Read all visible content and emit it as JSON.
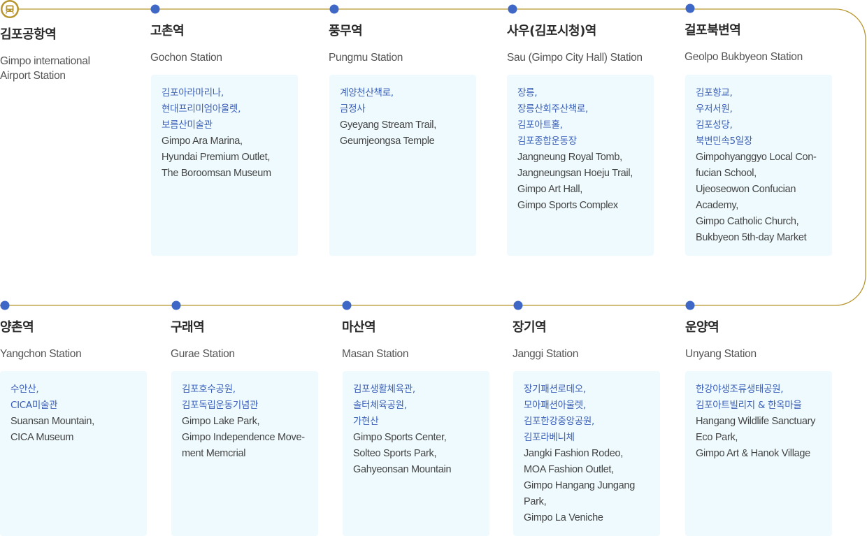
{
  "colors": {
    "track": "#b8962e",
    "dot": "#3f67c5",
    "airport_ring": "#b8962e",
    "card_bg": "#eefafd",
    "ko_text": "#3a5fb8"
  },
  "stations": [
    {
      "ko": "김포공항역",
      "en": "Gimpo international Airport Station",
      "icon": "train-icon",
      "lines": []
    },
    {
      "ko": "고촌역",
      "en": "Gochon Station",
      "lines": [
        {
          "t": "김포아라마리나,",
          "k": true
        },
        {
          "t": "현대프리미엄아울렛,",
          "k": true
        },
        {
          "t": "보름산미술관",
          "k": true
        },
        {
          "t": "Gimpo Ara Marina,",
          "k": false
        },
        {
          "t": "Hyundai Premium Outlet,",
          "k": false
        },
        {
          "t": "The Boroomsan Museum",
          "k": false
        }
      ]
    },
    {
      "ko": "풍무역",
      "en": "Pungmu Station",
      "lines": [
        {
          "t": "계양천산책로,",
          "k": true
        },
        {
          "t": "금정사",
          "k": true
        },
        {
          "t": "Gyeyang Stream Trail,",
          "k": false
        },
        {
          "t": "Geumjeongsa Temple",
          "k": false
        }
      ]
    },
    {
      "ko": "사우(김포시청)역",
      "en": "Sau (Gimpo City Hall) Station",
      "lines": [
        {
          "t": "장릉,",
          "k": true
        },
        {
          "t": "장릉산회주산책로,",
          "k": true
        },
        {
          "t": "김포아트홀,",
          "k": true
        },
        {
          "t": "김포종합운동장",
          "k": true
        },
        {
          "t": "Jangneung Royal Tomb,",
          "k": false
        },
        {
          "t": "Jangneungsan Hoeju Trail,",
          "k": false
        },
        {
          "t": "Gimpo Art Hall,",
          "k": false
        },
        {
          "t": "Gimpo Sports Complex",
          "k": false
        }
      ]
    },
    {
      "ko": "걸포북변역",
      "en": "Geolpo Bukbyeon Station",
      "lines": [
        {
          "t": "김포향교,",
          "k": true
        },
        {
          "t": "우저서원,",
          "k": true
        },
        {
          "t": "김포성당,",
          "k": true
        },
        {
          "t": "북변민속5일장",
          "k": true
        },
        {
          "t": "Gimpohyanggyo Local Con-",
          "k": false
        },
        {
          "t": "fucian School,",
          "k": false
        },
        {
          "t": "Ujeoseowon Confucian",
          "k": false
        },
        {
          "t": "Academy,",
          "k": false
        },
        {
          "t": "Gimpo Catholic Church,",
          "k": false
        },
        {
          "t": "Bukbyeon 5th-day Market",
          "k": false
        }
      ]
    },
    {
      "ko": "양촌역",
      "en": "Yangchon Station",
      "lines": [
        {
          "t": "수안산,",
          "k": true
        },
        {
          "t": "CICA미술관",
          "k": true
        },
        {
          "t": "Suansan Mountain,",
          "k": false
        },
        {
          "t": "CICA Museum",
          "k": false
        }
      ]
    },
    {
      "ko": "구래역",
      "en": "Gurae Station",
      "lines": [
        {
          "t": "김포호수공원,",
          "k": true
        },
        {
          "t": "김포독립운동기념관",
          "k": true
        },
        {
          "t": "Gimpo Lake Park,",
          "k": false
        },
        {
          "t": "Gimpo Independence Move-",
          "k": false
        },
        {
          "t": "ment Memcrial",
          "k": false
        }
      ]
    },
    {
      "ko": "마산역",
      "en": "Masan Station",
      "lines": [
        {
          "t": "김포생활체육관,",
          "k": true
        },
        {
          "t": "솔터체육공원,",
          "k": true
        },
        {
          "t": "가현산",
          "k": true
        },
        {
          "t": "Gimpo Sports Center,",
          "k": false
        },
        {
          "t": "Solteo Sports Park,",
          "k": false
        },
        {
          "t": "Gahyeonsan Mountain",
          "k": false
        }
      ]
    },
    {
      "ko": "장기역",
      "en": "Janggi Station",
      "lines": [
        {
          "t": "장기패션로데오,",
          "k": true
        },
        {
          "t": "모아패션아울렛,",
          "k": true
        },
        {
          "t": "김포한강중앙공원,",
          "k": true
        },
        {
          "t": "김포라베니체",
          "k": true
        },
        {
          "t": "Jangki Fashion Rodeo,",
          "k": false
        },
        {
          "t": "MOA Fashion Outlet,",
          "k": false
        },
        {
          "t": "Gimpo Hangang Jungang",
          "k": false
        },
        {
          "t": "Park,",
          "k": false
        },
        {
          "t": "Gimpo La Veniche",
          "k": false
        }
      ]
    },
    {
      "ko": "운양역",
      "en": "Unyang Station",
      "lines": [
        {
          "t": "한강야생조류생태공원,",
          "k": true
        },
        {
          "t": "김포아트빌리지 & 한옥마을",
          "k": true
        },
        {
          "t": "Hangang Wildlife Sanctuary",
          "k": false
        },
        {
          "t": "Eco Park,",
          "k": false
        },
        {
          "t": "Gimpo Art & Hanok Village",
          "k": false
        }
      ]
    }
  ]
}
